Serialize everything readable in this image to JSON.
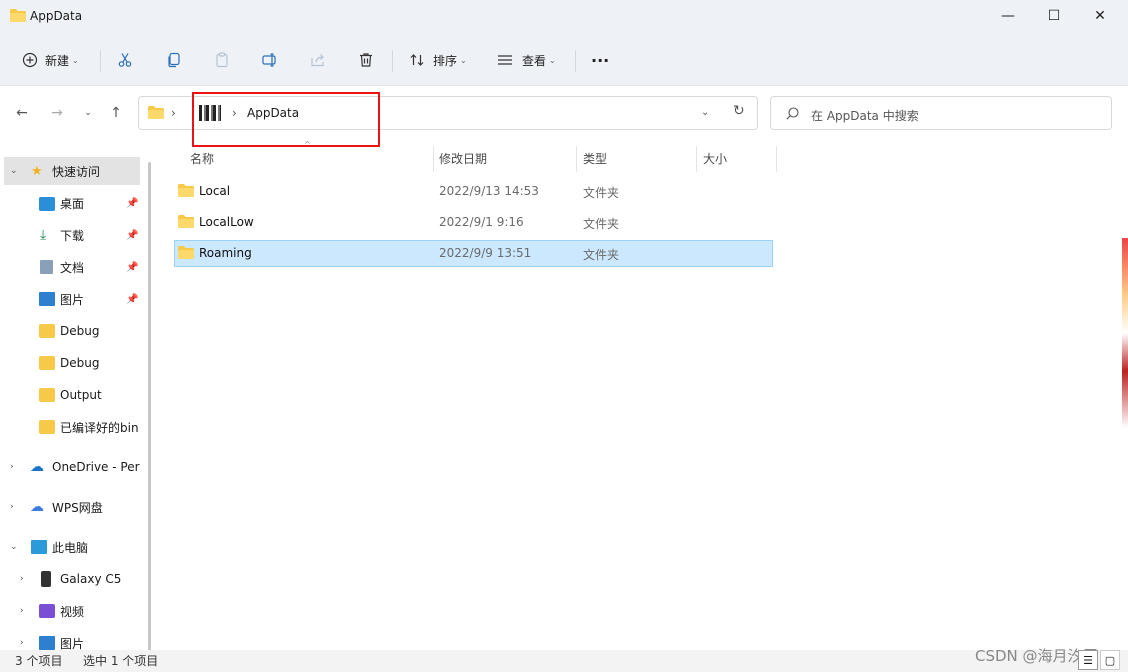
{
  "window": {
    "title": "AppData",
    "min_glyph": "—",
    "max_glyph": "☐",
    "close_glyph": "✕"
  },
  "toolbar": {
    "new_label": "新建",
    "sort_label": "排序",
    "view_label": "查看",
    "more_label": "···"
  },
  "address": {
    "user_segment": " ",
    "current": "AppData"
  },
  "search": {
    "placeholder": "在 AppData 中搜索"
  },
  "sidebar": {
    "quick_access": "快速访问",
    "items": [
      {
        "label": "桌面",
        "icon": "desktop-icon",
        "pinned": true
      },
      {
        "label": "下载",
        "icon": "download-icon",
        "pinned": true
      },
      {
        "label": "文档",
        "icon": "document-icon",
        "pinned": true
      },
      {
        "label": "图片",
        "icon": "pictures-icon",
        "pinned": true
      },
      {
        "label": "Debug",
        "icon": "folder-icon",
        "pinned": false
      },
      {
        "label": "Debug",
        "icon": "folder-icon",
        "pinned": false
      },
      {
        "label": "Output",
        "icon": "folder-icon",
        "pinned": false
      },
      {
        "label": "已编译好的bin",
        "icon": "folder-icon",
        "pinned": false
      }
    ],
    "onedrive": "OneDrive - Pers",
    "wps": "WPS网盘",
    "this_pc": "此电脑",
    "pc_items": [
      {
        "label": "Galaxy C5",
        "icon": "phone-icon"
      },
      {
        "label": "视频",
        "icon": "video-icon"
      },
      {
        "label": "图片",
        "icon": "pictures-icon"
      }
    ]
  },
  "columns": {
    "name": "名称",
    "modified": "修改日期",
    "type": "类型",
    "size": "大小"
  },
  "files": [
    {
      "name": "Local",
      "modified": "2022/9/13 14:53",
      "type": "文件夹",
      "selected": false
    },
    {
      "name": "LocalLow",
      "modified": "2022/9/1 9:16",
      "type": "文件夹",
      "selected": false
    },
    {
      "name": "Roaming",
      "modified": "2022/9/9 13:51",
      "type": "文件夹",
      "selected": true
    }
  ],
  "status": {
    "count": "3 个项目",
    "selection": "选中 1 个项目"
  },
  "watermark": "CSDN @海月汐辰",
  "colors": {
    "accent_selected": "#cce8ff",
    "folder": "#f7c948",
    "annotation": "#e11111"
  }
}
